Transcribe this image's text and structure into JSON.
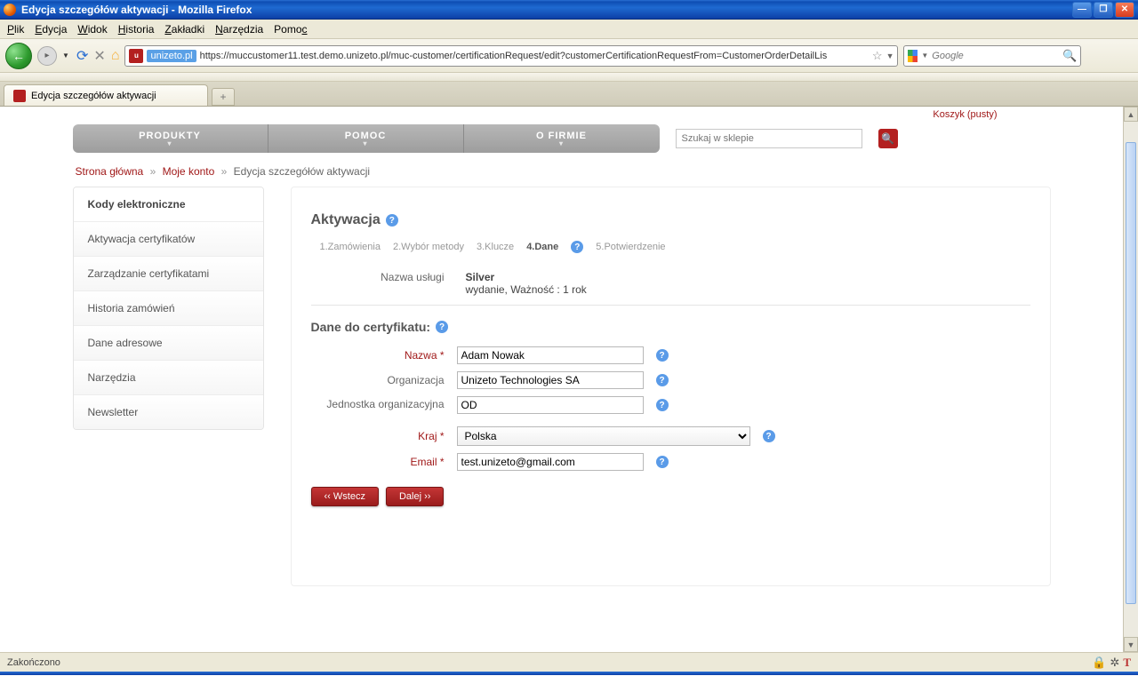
{
  "window": {
    "title": "Edycja szczegółów aktywacji - Mozilla Firefox",
    "menus": [
      "Plik",
      "Edycja",
      "Widok",
      "Historia",
      "Zakładki",
      "Narzędzia",
      "Pomoc"
    ],
    "url_domain": "unizeto.pl",
    "url_rest": "https://muccustomer11.test.demo.unizeto.pl/muc-customer/certificationRequest/edit?customerCertificationRequestFrom=CustomerOrderDetailLis",
    "search_placeholder": "Google",
    "tab_label": "Edycja szczegółów aktywacji",
    "status": "Zakończono"
  },
  "topstrip": {
    "cart": "Koszyk (pusty)"
  },
  "nav": {
    "items": [
      "PRODUKTY",
      "POMOC",
      "O FIRMIE"
    ]
  },
  "shop_search_placeholder": "Szukaj w sklepie",
  "breadcrumb": {
    "home": "Strona główna",
    "account": "Moje konto",
    "current": "Edycja szczegółów aktywacji"
  },
  "sidebar": {
    "items": [
      "Kody elektroniczne",
      "Aktywacja certyfikatów",
      "Zarządzanie certyfikatami",
      "Historia zamówień",
      "Dane adresowe",
      "Narzędzia",
      "Newsletter"
    ]
  },
  "main": {
    "heading": "Aktywacja",
    "steps": [
      "1.Zamówienia",
      "2.Wybór metody",
      "3.Klucze",
      "4.Dane",
      "5.Potwierdzenie"
    ],
    "active_step_index": 3,
    "service_label": "Nazwa usługi",
    "service_name": "Silver",
    "service_detail": "wydanie, Ważność : 1 rok",
    "section_title": "Dane do certyfikatu:",
    "fields": {
      "name_label": "Nazwa *",
      "name_value": "Adam Nowak",
      "org_label": "Organizacja",
      "org_value": "Unizeto Technologies SA",
      "unit_label": "Jednostka organizacyjna",
      "unit_value": "OD",
      "country_label": "Kraj *",
      "country_value": "Polska",
      "email_label": "Email *",
      "email_value": "test.unizeto@gmail.com"
    },
    "btn_back": "‹‹ Wstecz",
    "btn_next": "Dalej ››"
  }
}
